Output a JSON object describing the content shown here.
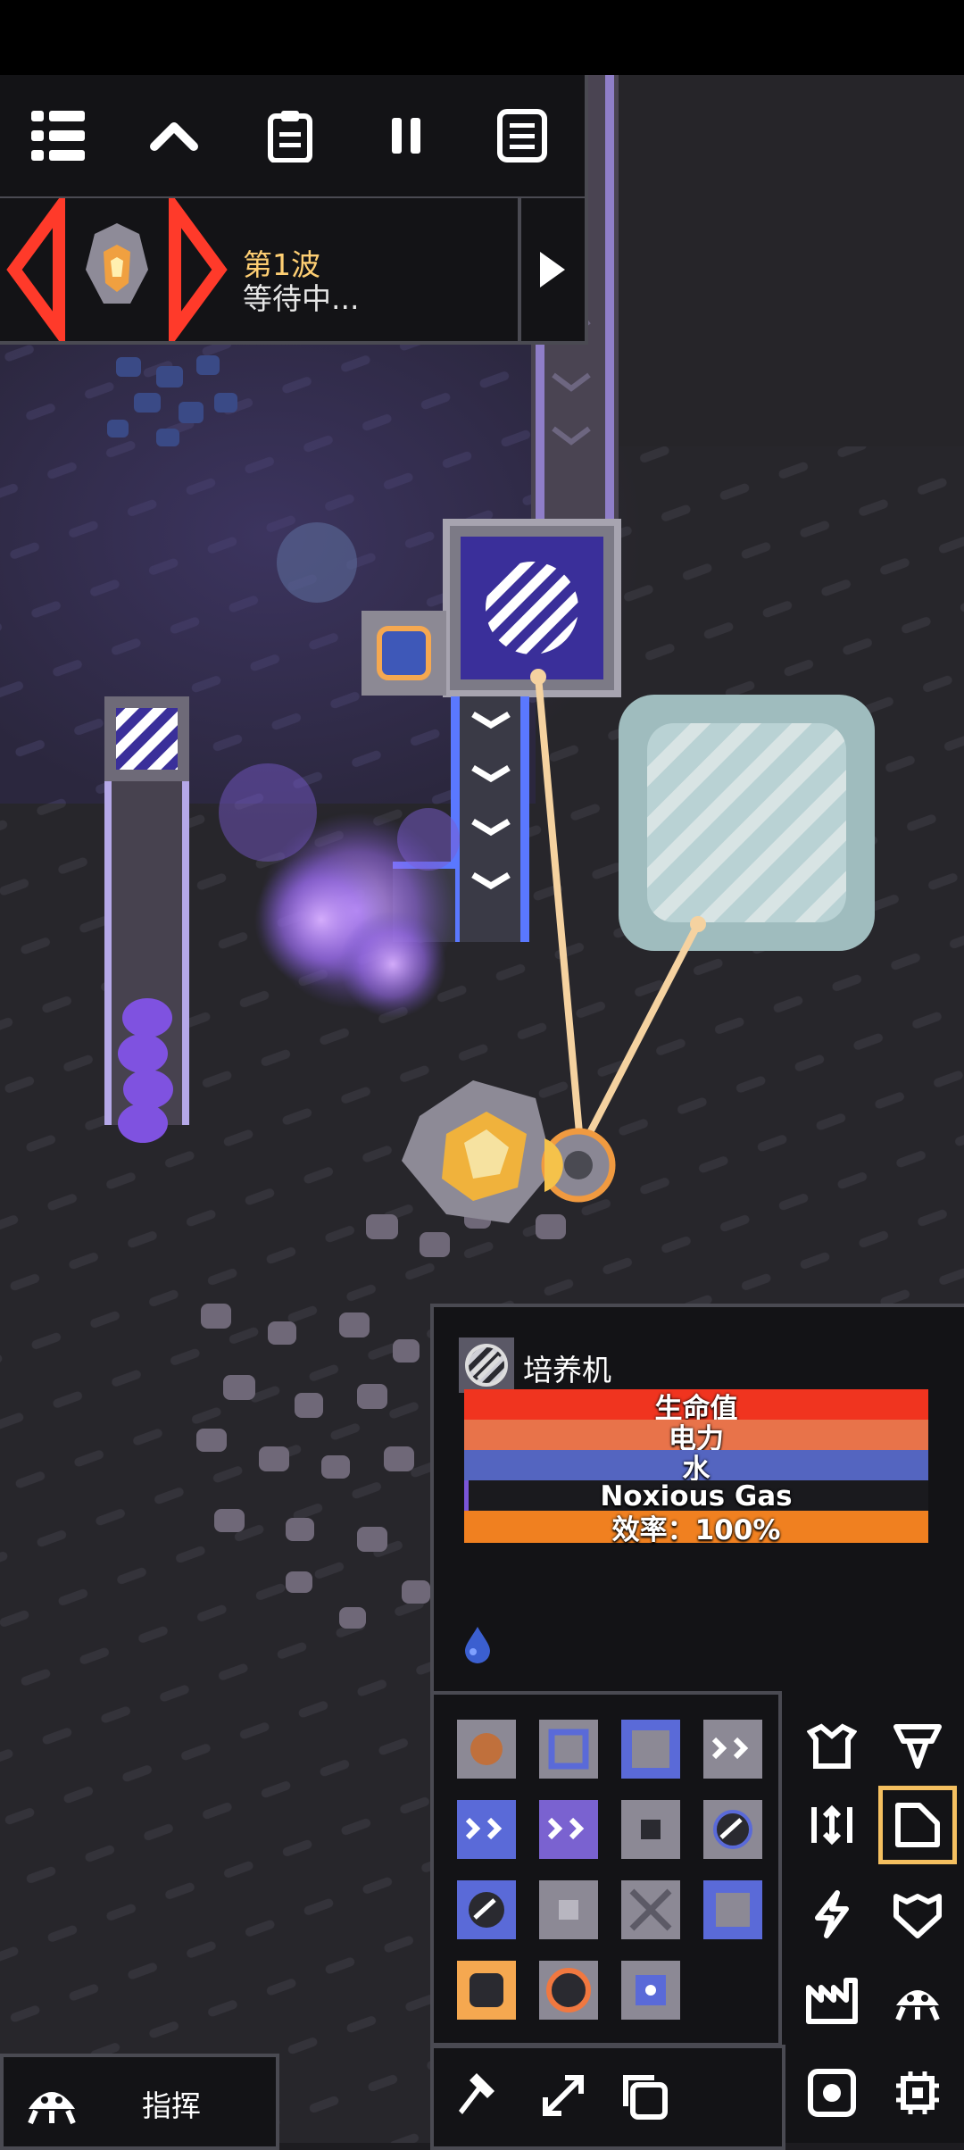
{
  "wave": {
    "title": "第1波",
    "status": "等待中..."
  },
  "menu_buttons": [
    "menu-icon",
    "chevron-up-icon",
    "clipboard-icon",
    "pause-icon",
    "database-icon"
  ],
  "info_panel": {
    "block_name": "培养机",
    "bars": [
      {
        "label": "生命值",
        "color": "#f0341f",
        "fraction": 1.0
      },
      {
        "label": "电力",
        "color": "#e8734a",
        "fraction": 1.0
      },
      {
        "label": "水",
        "color": "#5465c0",
        "fraction": 1.0
      },
      {
        "label": "Noxious Gas",
        "color": "#7a55d8",
        "fraction": 0.01
      },
      {
        "label": "效率：100%",
        "color": "#f08020",
        "fraction": 1.0
      }
    ],
    "fluid_icon": "water-drop-icon"
  },
  "command": {
    "label": "指挥"
  },
  "colors": {
    "panel": "#131316",
    "border": "#4a4a52",
    "accent": "#ffcf73",
    "selected": "#f5c060"
  }
}
